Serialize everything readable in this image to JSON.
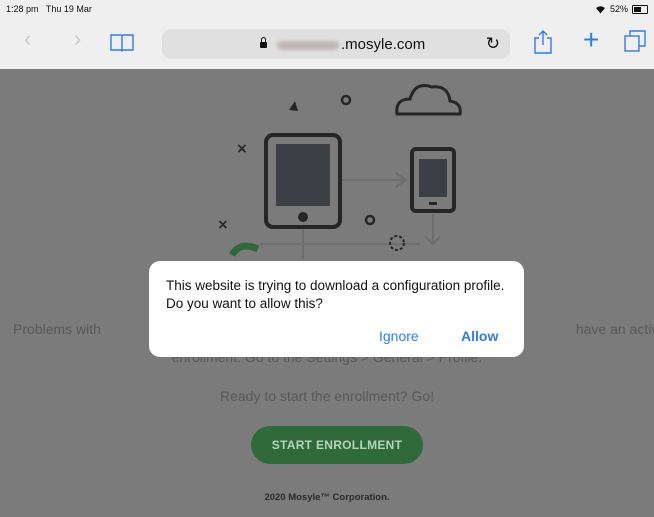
{
  "status_bar": {
    "time": "1:28 pm",
    "date": "Thu 19 Mar",
    "battery": "52%"
  },
  "toolbar": {
    "url_domain": ".mosyle.com"
  },
  "page": {
    "problems_text": "Problems with                                                                                    have an active",
    "problems_text_left": "Problems with",
    "problems_text_right": "have an active",
    "enrollment_text": "enrollment. Go to the Settings > General > Profile.",
    "ready_text": "Ready to start the enrollment? Go!",
    "start_button": "START ENROLLMENT",
    "footer": "2020 Mosyle™ Corporation."
  },
  "dialog": {
    "message": "This website is trying to download a configuration profile. Do you want to allow this?",
    "ignore_label": "Ignore",
    "allow_label": "Allow"
  }
}
